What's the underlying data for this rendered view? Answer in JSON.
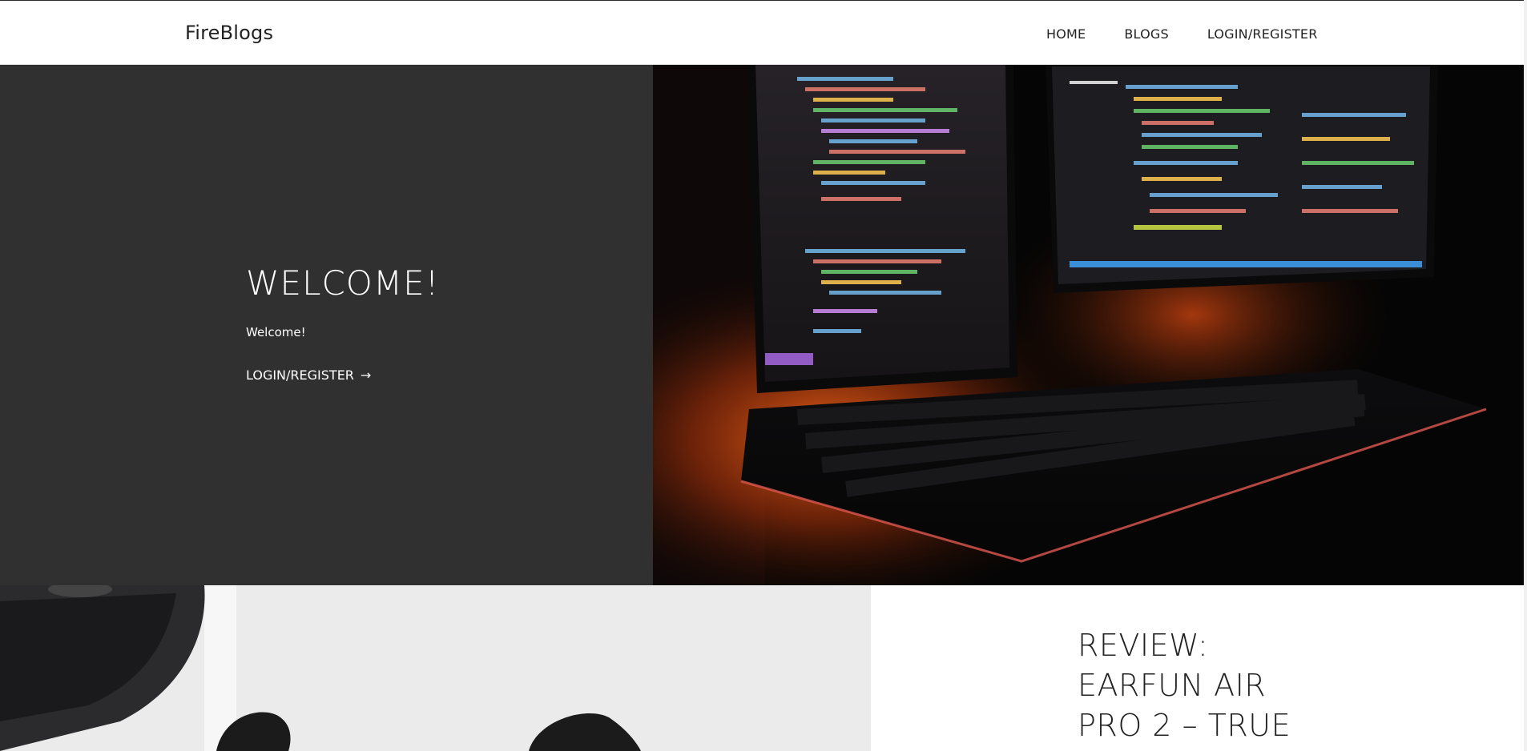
{
  "header": {
    "brand": "FireBlogs",
    "nav": [
      {
        "label": "HOME"
      },
      {
        "label": "BLOGS"
      },
      {
        "label": "LOGIN/REGISTER"
      }
    ]
  },
  "hero": {
    "title": "WELCOME!",
    "subtitle": "Welcome!",
    "cta_label": "LOGIN/REGISTER",
    "cta_icon": "arrow-right-icon",
    "image_alt": "computer-monitors-keyboard-image"
  },
  "post": {
    "title": "REVIEW: EARFUN AIR PRO 2 – TRUE",
    "image_alt": "earbuds-image"
  },
  "colors": {
    "hero_bg": "#303030",
    "text_dark": "#222222",
    "text_light": "#ffffff"
  }
}
